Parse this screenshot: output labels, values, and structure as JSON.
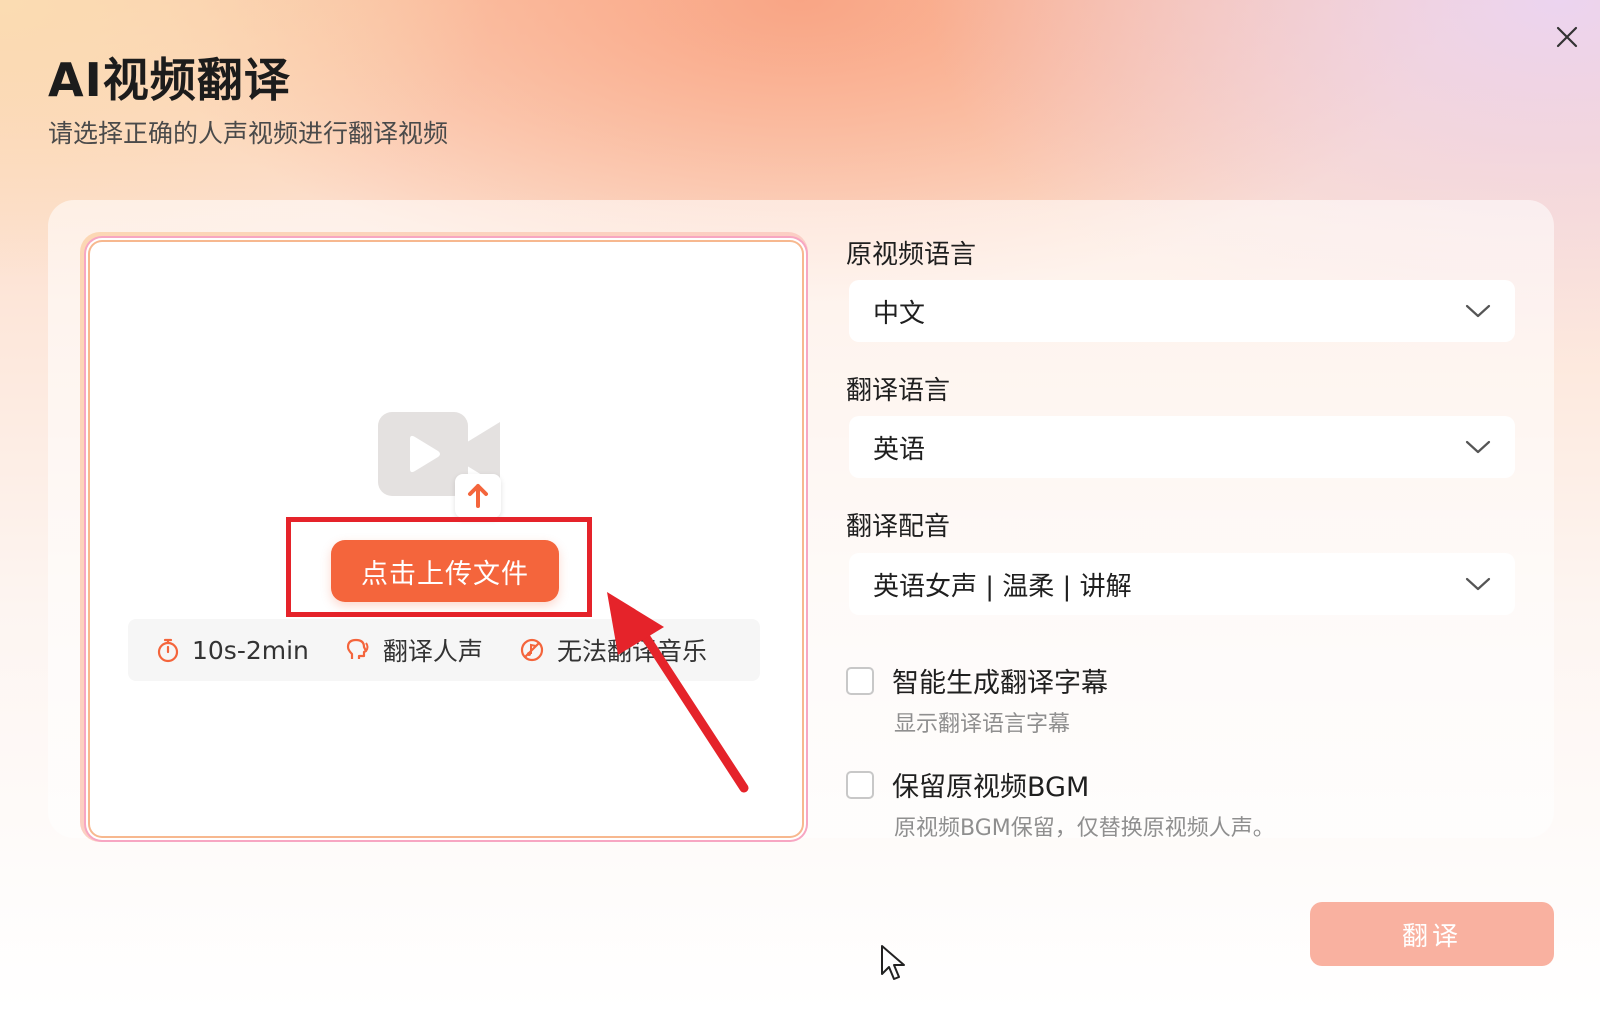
{
  "dialog": {
    "title": "AI视频翻译",
    "subtitle": "请选择正确的人声视频进行翻译视频",
    "close_icon": "close-icon"
  },
  "upload": {
    "button_label": "点击上传文件",
    "icon": "video-upload-icon",
    "hints": [
      {
        "icon": "timer-icon",
        "text": "10s-2min"
      },
      {
        "icon": "voice-head-icon",
        "text": "翻译人声"
      },
      {
        "icon": "no-music-icon",
        "text": "无法翻译音乐"
      }
    ],
    "accent": "#f4653c",
    "highlight_color": "#e5232a"
  },
  "settings": {
    "source_language": {
      "label": "原视频语言",
      "value": "中文"
    },
    "target_language": {
      "label": "翻译语言",
      "value": "英语"
    },
    "dubbing": {
      "label": "翻译配音",
      "value": "英语女声 | 温柔 | 讲解"
    },
    "subtitle_option": {
      "label": "智能生成翻译字幕",
      "description": "显示翻译语言字幕",
      "checked": false
    },
    "bgm_option": {
      "label": "保留原视频BGM",
      "description": "原视频BGM保留，仅替换原视频人声。",
      "checked": false
    }
  },
  "footer": {
    "translate_button": "翻译",
    "button_color": "#f9b1a0"
  }
}
